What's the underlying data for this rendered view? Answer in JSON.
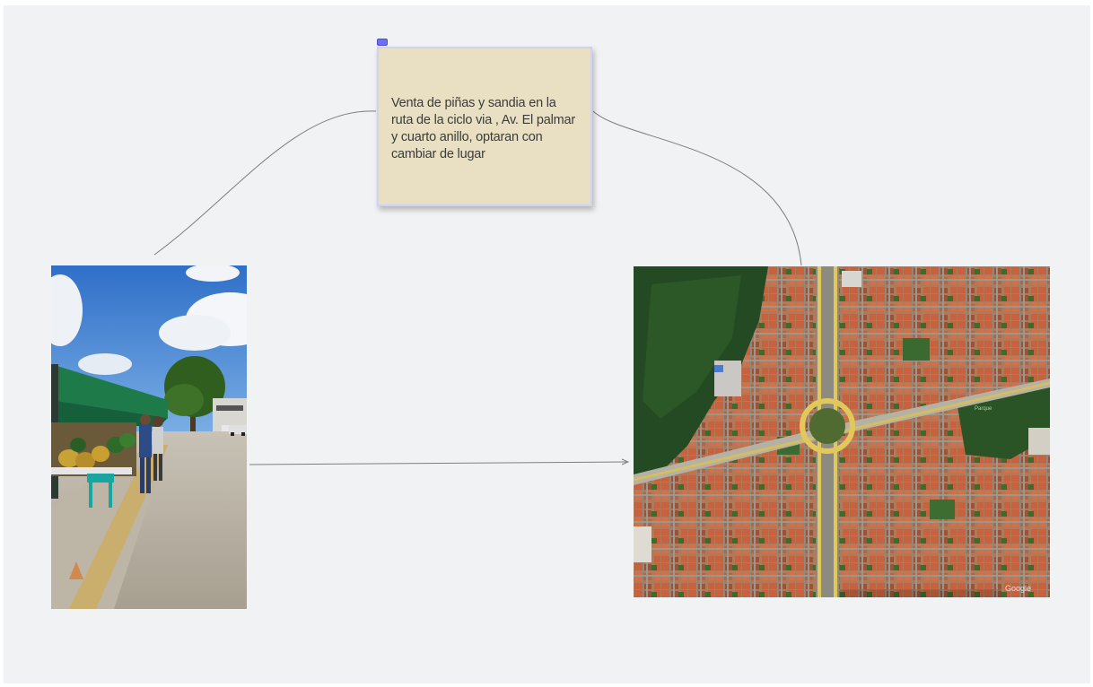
{
  "board": {
    "sticky_note": {
      "text": "Venta de piñas y sandia en la ruta de la ciclo via , Av. El palmar y cuarto anillo, optaran con cambiar de lugar",
      "color": "#e9e0c3"
    },
    "photo": {
      "subject": "street fruit stall with pineapples and watermelons under green canopy"
    },
    "map": {
      "subject": "satellite view of roundabout intersection in urban neighborhood",
      "watermark": "Google"
    },
    "colors": {
      "canvas": "#f1f2f4",
      "connector": "#7d7d7d",
      "selection": "#6f6ff5"
    }
  }
}
